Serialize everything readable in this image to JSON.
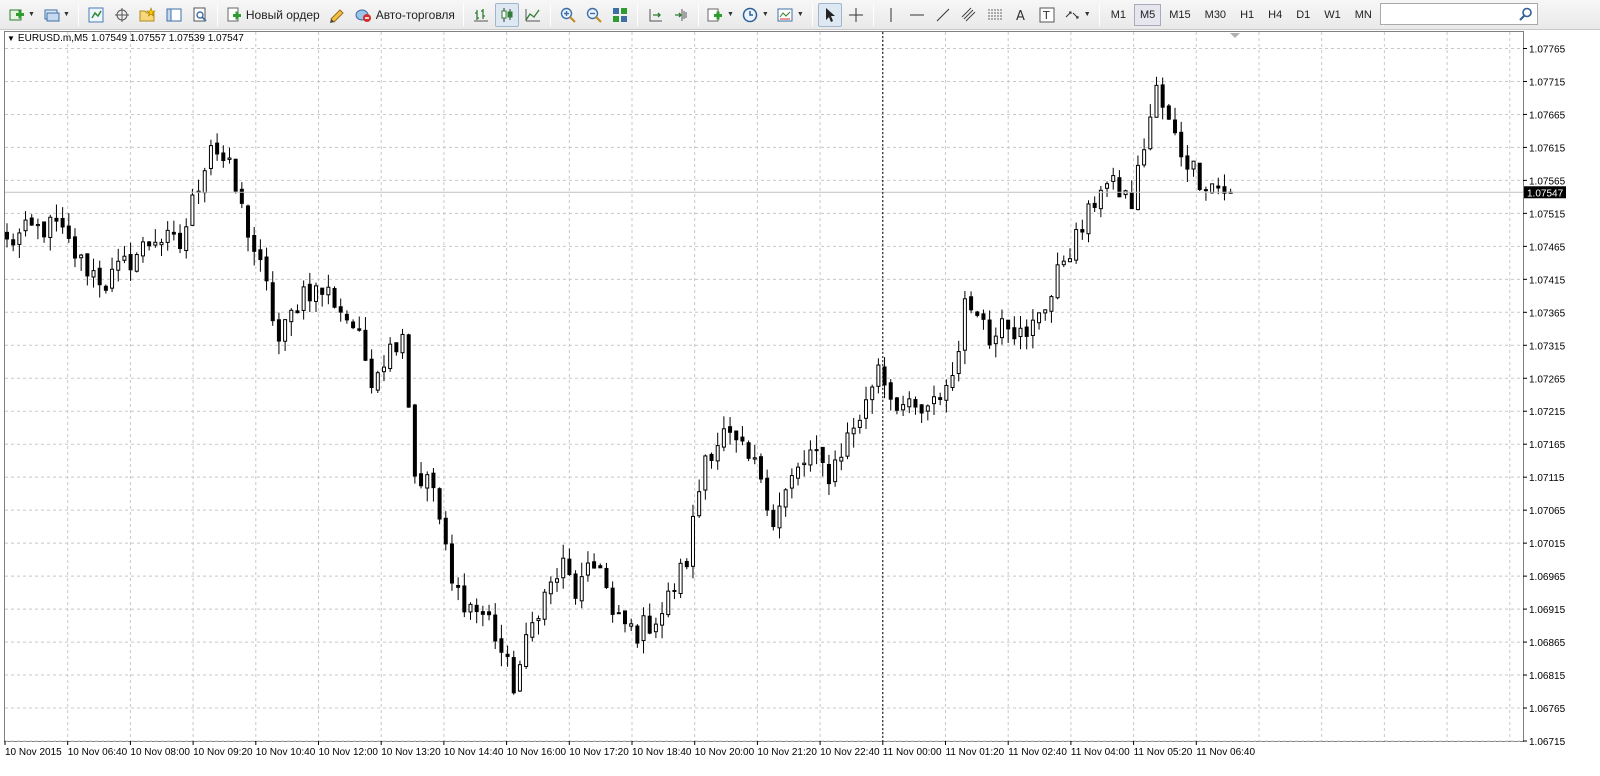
{
  "toolbar": {
    "new_order_label": "Новый ордер",
    "auto_trading_label": "Авто-торговля",
    "timeframes": [
      "M1",
      "M5",
      "M15",
      "M30",
      "H1",
      "H4",
      "D1",
      "W1",
      "MN"
    ],
    "active_timeframe": "M5",
    "search": {
      "value": "",
      "placeholder": ""
    }
  },
  "chart": {
    "header": {
      "symbol": "EURUSD.m,M5",
      "ohlc": "1.07549 1.07557 1.07539 1.07547"
    },
    "current_price_label": "1.07547",
    "colors": {
      "grid": "#c8c8c8",
      "candle": "#000000",
      "price_line": "#c0c0c0",
      "price_tag_bg": "#000000",
      "price_tag_text": "#ffffff"
    }
  },
  "chart_data": {
    "type": "candlestick",
    "symbol": "EURUSD.m",
    "timeframe": "M5",
    "y_ticks": [
      "1.07765",
      "1.07715",
      "1.07665",
      "1.07615",
      "1.07565",
      "1.07515",
      "1.07465",
      "1.07415",
      "1.07365",
      "1.07315",
      "1.07265",
      "1.07215",
      "1.07165",
      "1.07115",
      "1.07065",
      "1.07015",
      "1.06965",
      "1.06915",
      "1.06865",
      "1.06815",
      "1.06765",
      "1.06715"
    ],
    "x_ticks": [
      "10 Nov 2015",
      "10 Nov 06:40",
      "10 Nov 08:00",
      "10 Nov 09:20",
      "10 Nov 10:40",
      "10 Nov 12:00",
      "10 Nov 13:20",
      "10 Nov 14:40",
      "10 Nov 16:00",
      "10 Nov 17:20",
      "10 Nov 18:40",
      "10 Nov 20:00",
      "10 Nov 21:20",
      "10 Nov 22:40",
      "11 Nov 00:00",
      "11 Nov 01:20",
      "11 Nov 02:40",
      "11 Nov 04:00",
      "11 Nov 05:20",
      "11 Nov 06:40"
    ],
    "ylim": [
      1.06715,
      1.0779
    ],
    "last_price": 1.07547,
    "close_path": [
      [
        0,
        1.0747
      ],
      [
        4,
        1.0749
      ],
      [
        8,
        1.07495
      ],
      [
        12,
        1.0744
      ],
      [
        16,
        1.0741
      ],
      [
        20,
        1.07445
      ],
      [
        24,
        1.0748
      ],
      [
        28,
        1.07465
      ],
      [
        30,
        1.0753
      ],
      [
        33,
        1.07625
      ],
      [
        36,
        1.0758
      ],
      [
        39,
        1.0749
      ],
      [
        42,
        1.074
      ],
      [
        44,
        1.0732
      ],
      [
        48,
        1.074
      ],
      [
        52,
        1.07395
      ],
      [
        56,
        1.07345
      ],
      [
        59,
        1.0727
      ],
      [
        62,
        1.0731
      ],
      [
        64,
        1.0734
      ],
      [
        66,
        1.0712
      ],
      [
        69,
        1.071
      ],
      [
        72,
        1.0695
      ],
      [
        75,
        1.0692
      ],
      [
        78,
        1.069
      ],
      [
        82,
        1.068
      ],
      [
        86,
        1.0692
      ],
      [
        90,
        1.0698
      ],
      [
        92,
        1.0694
      ],
      [
        96,
        1.0699
      ],
      [
        98,
        1.069
      ],
      [
        102,
        1.0688
      ],
      [
        106,
        1.0691
      ],
      [
        110,
        1.0699
      ],
      [
        113,
        1.0715
      ],
      [
        116,
        1.0718
      ],
      [
        119,
        1.0715
      ],
      [
        122,
        1.0712
      ],
      [
        124,
        1.0705
      ],
      [
        127,
        1.0711
      ],
      [
        130,
        1.0715
      ],
      [
        133,
        1.0712
      ],
      [
        136,
        1.07175
      ],
      [
        139,
        1.07225
      ],
      [
        141,
        1.0729
      ],
      [
        143,
        1.0724
      ],
      [
        146,
        1.07215
      ],
      [
        149,
        1.0721
      ],
      [
        151,
        1.0724
      ],
      [
        153,
        1.0727
      ],
      [
        155,
        1.0737
      ],
      [
        157,
        1.0738
      ],
      [
        159,
        1.0732
      ],
      [
        161,
        1.0737
      ],
      [
        163,
        1.0734
      ],
      [
        165,
        1.0732
      ],
      [
        167,
        1.0737
      ],
      [
        169,
        1.0739
      ],
      [
        171,
        1.0745
      ],
      [
        173,
        1.07475
      ],
      [
        175,
        1.0751
      ],
      [
        177,
        1.0756
      ],
      [
        180,
        1.0755
      ],
      [
        182,
        1.0753
      ],
      [
        184,
        1.0762
      ],
      [
        186,
        1.077
      ],
      [
        188,
        1.0765
      ],
      [
        190,
        1.0761
      ],
      [
        193,
        1.0757
      ],
      [
        196,
        1.07555
      ],
      [
        198,
        1.07547
      ]
    ],
    "crosshair_x_label": "11 Nov 00:00"
  }
}
